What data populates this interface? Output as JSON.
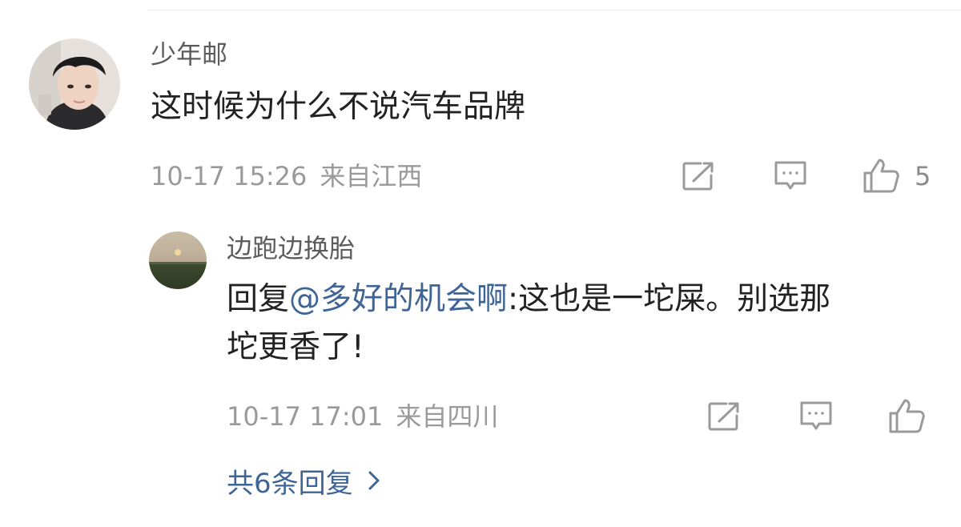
{
  "comment": {
    "username": "少年邮",
    "text": "这时候为什么不说汽车品牌",
    "date": "10-17 15:26",
    "location": "来自江西",
    "like_count": "5",
    "icons": [
      "share-icon",
      "reply-icon",
      "like-icon"
    ]
  },
  "reply": {
    "username": "边跑边换胎",
    "prefix": "回复",
    "mention": "@多好的机会啊",
    "text_line1": ":这也是一坨屎。别选那",
    "text_line2": "坨更香了!",
    "date": "10-17 17:01",
    "location": "来自四川",
    "icons": [
      "share-icon",
      "reply-icon",
      "like-icon"
    ]
  },
  "more_replies": {
    "label": "共6条回复",
    "icon": "chevron-right-icon"
  },
  "colors": {
    "link": "#3f6496",
    "meta": "#9a9a9a",
    "username": "#5c5c5c",
    "text": "#222222"
  }
}
